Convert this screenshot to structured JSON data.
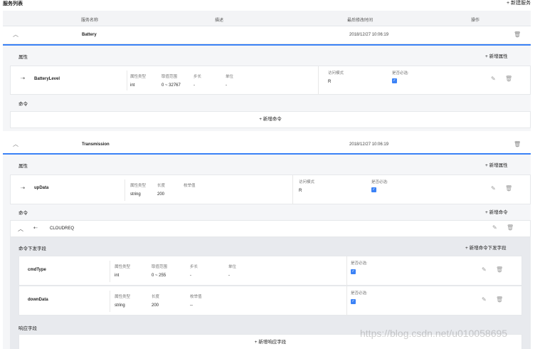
{
  "page": {
    "title": "服务列表",
    "new_service": "+ 新建服务"
  },
  "table": {
    "headers": [
      "服务名称",
      "描述",
      "最后修改时间",
      "操作"
    ]
  },
  "services": [
    {
      "name": "Battery",
      "modified": "2018/12/27 10:06:19",
      "properties_label": "属性",
      "add_property": "+ 新增属性",
      "property": {
        "name": "BatteryLevel",
        "type_label": "属性类型",
        "type": "int",
        "range_label": "取值范围",
        "range": "0 ~ 32767",
        "step_label": "步长",
        "step": "-",
        "unit_label": "单位",
        "unit": "-",
        "access_label": "访问模式",
        "access": "R",
        "required_label": "是否必选:"
      },
      "commands_label": "命令",
      "add_command": "+ 新增命令"
    },
    {
      "name": "Transmission",
      "modified": "2018/12/27 10:06:19",
      "properties_label": "属性",
      "add_property": "+ 新增属性",
      "property": {
        "name": "upData",
        "type_label": "属性类型",
        "type": "string",
        "length_label": "长度",
        "length": "200",
        "enum_label": "枚举值",
        "access_label": "访问模式",
        "access": "R",
        "required_label": "是否必选:"
      },
      "commands_label": "命令",
      "add_command": "+ 新增命令",
      "command": {
        "name": "CLOUDREQ",
        "fields_label": "命令下发字段",
        "add_field": "+ 新增命令下发字段",
        "fields": [
          {
            "name": "cmdType",
            "type_label": "属性类型",
            "type": "int",
            "range_label": "取值范围",
            "range": "0 ~ 255",
            "step_label": "步长",
            "step": "-",
            "unit_label": "单位",
            "unit": "-",
            "required_label": "是否必选:"
          },
          {
            "name": "downData",
            "type_label": "属性类型",
            "type": "string",
            "length_label": "长度",
            "length": "200",
            "enum_label": "枚举值",
            "enum": "--",
            "required_label": "是否必选:"
          }
        ],
        "response_label": "响应字段",
        "add_response": "+ 新增响应字段"
      }
    }
  ],
  "watermark": "https://blog.csdn.net/u010058695",
  "colors": {
    "accent": "#3b82f6",
    "panel_bg": "#f5f6f8",
    "command_bg": "#e8eaee"
  }
}
